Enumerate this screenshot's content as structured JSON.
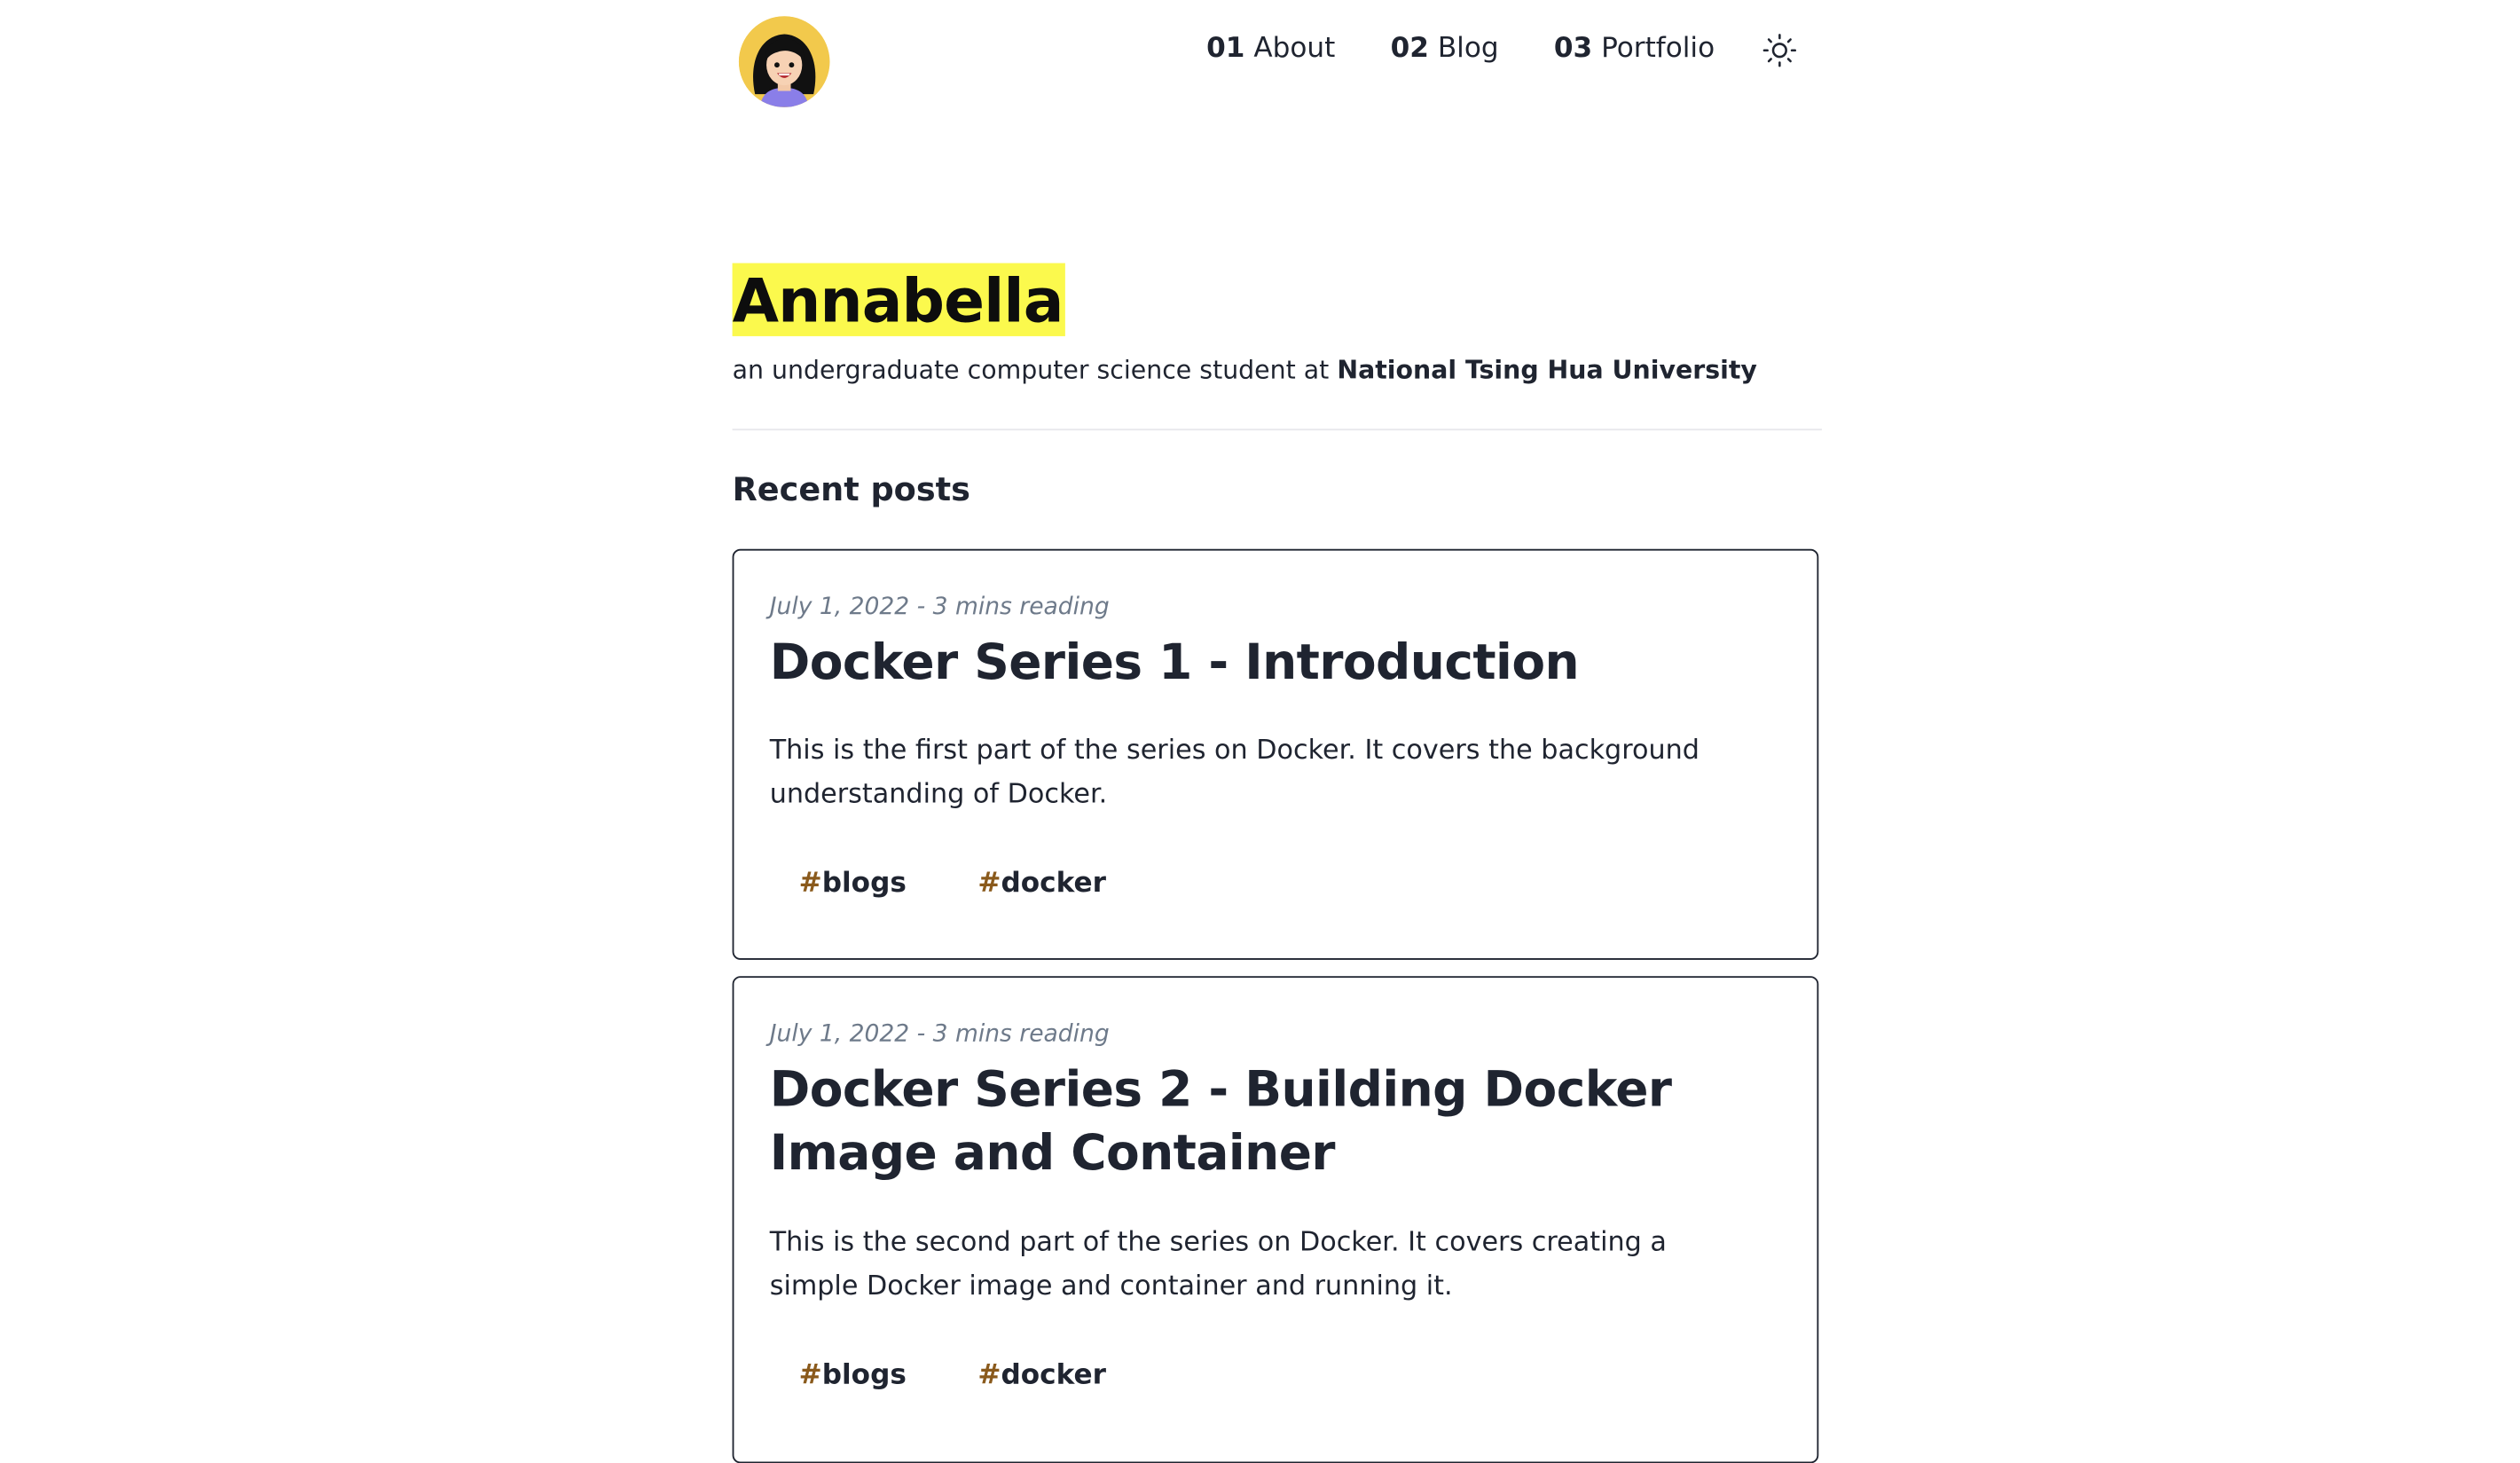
{
  "header": {
    "avatar_alt": "avatar",
    "nav": [
      {
        "num": "01",
        "label": "About"
      },
      {
        "num": "02",
        "label": "Blog"
      },
      {
        "num": "03",
        "label": "Portfolio"
      }
    ],
    "theme_icon": "sun-icon"
  },
  "hero": {
    "name": "Annabella",
    "subtitle_prefix": "an undergraduate computer science student at ",
    "subtitle_bold": "National Tsing Hua University"
  },
  "recent_posts": {
    "title": "Recent posts",
    "posts": [
      {
        "meta": "July 1, 2022 - 3 mins reading",
        "title": "Docker Series 1 - Introduction",
        "description": "This is the first part of the series on Docker. It covers the background understanding of Docker.",
        "tags": [
          "blogs",
          "docker"
        ]
      },
      {
        "meta": "July 1, 2022 - 3 mins reading",
        "title": "Docker Series 2 - Building Docker Image and Container",
        "description": "This is the second part of the series on Docker. It covers creating a simple Docker image and container and running it.",
        "tags": [
          "blogs",
          "docker"
        ]
      }
    ]
  },
  "colors": {
    "highlight": "#fbf94d",
    "text": "#1f2430",
    "meta": "#6e7a8a",
    "tag_hash": "#8a5a1c",
    "avatar_bg": "#f2c94c"
  }
}
